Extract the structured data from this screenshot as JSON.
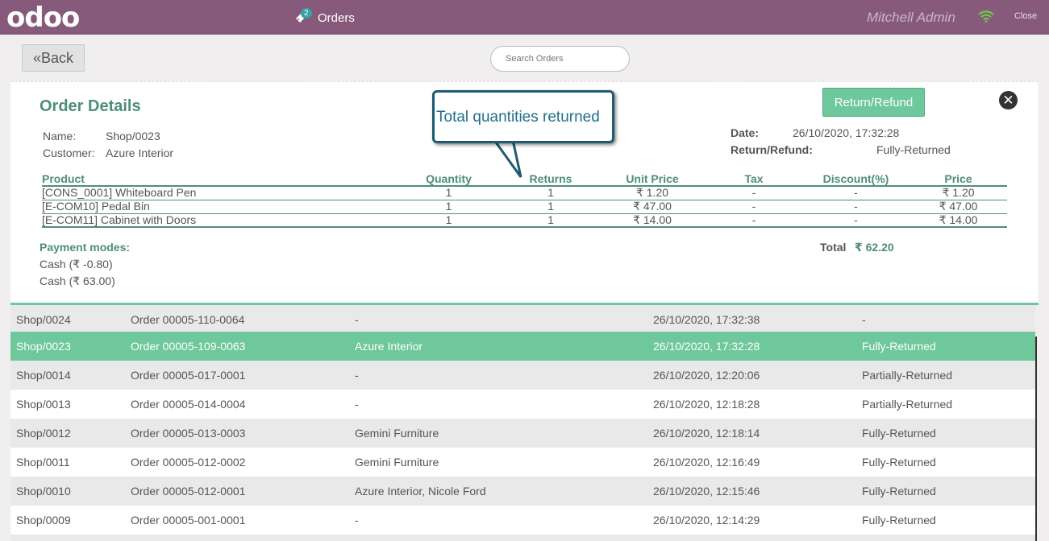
{
  "header": {
    "logo": "odoo",
    "orders_badge": "2",
    "orders_label": "Orders",
    "user": "Mitchell Admin",
    "close": "Close"
  },
  "toolbar": {
    "back_label": "Back",
    "search_placeholder": "Search Orders"
  },
  "details": {
    "title": "Order Details",
    "return_button": "Return/Refund",
    "name_label": "Name:",
    "name_value": "Shop/0023",
    "customer_label": "Customer:",
    "customer_value": "Azure Interior",
    "date_label": "Date:",
    "date_value": "26/10/2020, 17:32:28",
    "rr_label": "Return/Refund:",
    "rr_value": "Fully-Returned",
    "columns": [
      "Product",
      "Quantity",
      "Returns",
      "Unit Price",
      "Tax",
      "Discount(%)",
      "Price"
    ],
    "lines": [
      [
        "[CONS_0001] Whiteboard Pen",
        "1",
        "1",
        "₹ 1.20",
        "-",
        "-",
        "₹ 1.20"
      ],
      [
        "[E-COM10] Pedal Bin",
        "1",
        "1",
        "₹ 47.00",
        "-",
        "-",
        "₹ 47.00"
      ],
      [
        "[E-COM11] Cabinet with Doors",
        "1",
        "1",
        "₹ 14.00",
        "-",
        "-",
        "₹ 14.00"
      ]
    ],
    "payment_title": "Payment modes:",
    "payments": [
      "Cash (₹ -0.80)",
      "Cash (₹ 63.00)"
    ],
    "total_label": "Total",
    "total_value": "₹ 62.20"
  },
  "callout": {
    "text": "Total quantities returned"
  },
  "orders": [
    [
      "Shop/0024",
      "Order 00005-110-0064",
      "-",
      "26/10/2020, 17:32:38",
      "-"
    ],
    [
      "Shop/0023",
      "Order 00005-109-0063",
      "Azure Interior",
      "26/10/2020, 17:32:28",
      "Fully-Returned"
    ],
    [
      "Shop/0014",
      "Order 00005-017-0001",
      "-",
      "26/10/2020, 12:20:06",
      "Partially-Returned"
    ],
    [
      "Shop/0013",
      "Order 00005-014-0004",
      "-",
      "26/10/2020, 12:18:28",
      "Partially-Returned"
    ],
    [
      "Shop/0012",
      "Order 00005-013-0003",
      "Gemini Furniture",
      "26/10/2020, 12:18:14",
      "Fully-Returned"
    ],
    [
      "Shop/0011",
      "Order 00005-012-0002",
      "Gemini Furniture",
      "26/10/2020, 12:16:49",
      "Fully-Returned"
    ],
    [
      "Shop/0010",
      "Order 00005-012-0001",
      "Azure Interior, Nicole Ford",
      "26/10/2020, 12:15:46",
      "Fully-Returned"
    ],
    [
      "Shop/0009",
      "Order 00005-001-0001",
      "-",
      "26/10/2020, 12:14:29",
      "Fully-Returned"
    ]
  ],
  "selected_order_index": 1,
  "colors": {
    "brand": "#875a7b",
    "accent": "#6ec89b",
    "title_green": "#4d8e7b"
  }
}
